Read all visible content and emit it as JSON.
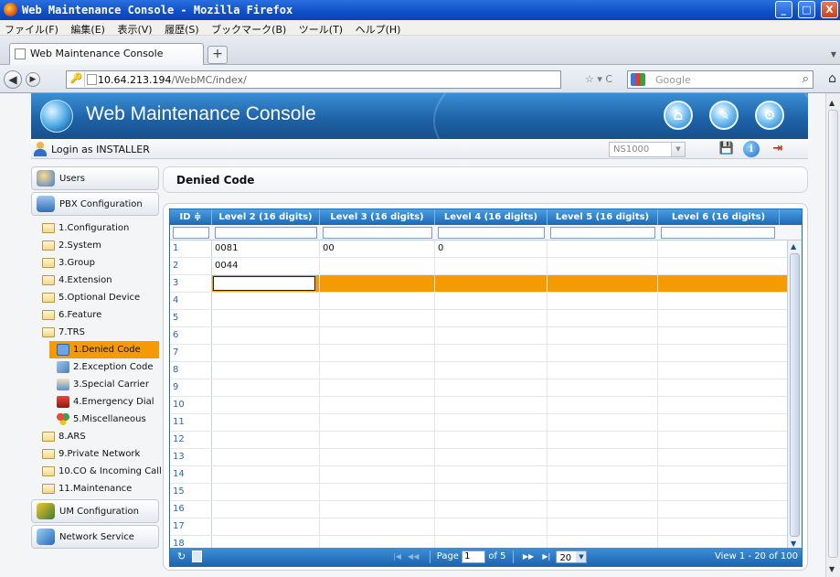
{
  "window": {
    "title": "Web Maintenance Console - Mozilla Firefox",
    "buttons": [
      "_",
      "□",
      "X"
    ]
  },
  "menubar": {
    "items": [
      "ファイル(F)",
      "編集(E)",
      "表示(V)",
      "履歴(S)",
      "ブックマーク(B)",
      "ツール(T)",
      "ヘルプ(H)"
    ]
  },
  "browser": {
    "tab_title": "Web Maintenance Console",
    "new_tab": "+",
    "url_host": "10.64.213.194",
    "url_path": "/WebMC/index/",
    "url_tools": "☆ ▾ C",
    "search_placeholder": "Google"
  },
  "app": {
    "title": "Web Maintenance Console",
    "login_text": "Login as INSTALLER",
    "system_select": "NS1000"
  },
  "sidebar": {
    "sections": {
      "users": "Users",
      "pbx": "PBX Configuration",
      "um": "UM Configuration",
      "network": "Network Service"
    },
    "tree": [
      "1.Configuration",
      "2.System",
      "3.Group",
      "4.Extension",
      "5.Optional Device",
      "6.Feature",
      "7.TRS"
    ],
    "trs_children": [
      "1.Denied Code",
      "2.Exception Code",
      "3.Special Carrier",
      "4.Emergency Dial",
      "5.Miscellaneous"
    ],
    "tree_after": [
      "8.ARS",
      "9.Private Network",
      "10.CO & Incoming Call",
      "11.Maintenance"
    ]
  },
  "main": {
    "page_title": "Denied Code",
    "columns": [
      "ID ≑",
      "Level 2 (16 digits)",
      "Level 3 (16 digits)",
      "Level 4 (16 digits)",
      "Level 5 (16 digits)",
      "Level 6 (16 digits)"
    ],
    "rows": [
      {
        "id": "1",
        "cells": [
          "0081",
          "00",
          "0",
          "",
          ""
        ]
      },
      {
        "id": "2",
        "cells": [
          "0044",
          "",
          "",
          "",
          ""
        ]
      },
      {
        "id": "3",
        "cells": [
          "",
          "",
          "",
          "",
          ""
        ]
      },
      {
        "id": "4",
        "cells": [
          "",
          "",
          "",
          "",
          ""
        ]
      },
      {
        "id": "5",
        "cells": [
          "",
          "",
          "",
          "",
          ""
        ]
      },
      {
        "id": "6",
        "cells": [
          "",
          "",
          "",
          "",
          ""
        ]
      },
      {
        "id": "7",
        "cells": [
          "",
          "",
          "",
          "",
          ""
        ]
      },
      {
        "id": "8",
        "cells": [
          "",
          "",
          "",
          "",
          ""
        ]
      },
      {
        "id": "9",
        "cells": [
          "",
          "",
          "",
          "",
          ""
        ]
      },
      {
        "id": "10",
        "cells": [
          "",
          "",
          "",
          "",
          ""
        ]
      },
      {
        "id": "11",
        "cells": [
          "",
          "",
          "",
          "",
          ""
        ]
      },
      {
        "id": "12",
        "cells": [
          "",
          "",
          "",
          "",
          ""
        ]
      },
      {
        "id": "13",
        "cells": [
          "",
          "",
          "",
          "",
          ""
        ]
      },
      {
        "id": "14",
        "cells": [
          "",
          "",
          "",
          "",
          ""
        ]
      },
      {
        "id": "15",
        "cells": [
          "",
          "",
          "",
          "",
          ""
        ]
      },
      {
        "id": "16",
        "cells": [
          "",
          "",
          "",
          "",
          ""
        ]
      },
      {
        "id": "17",
        "cells": [
          "",
          "",
          "",
          "",
          ""
        ]
      },
      {
        "id": "18",
        "cells": [
          "",
          "",
          "",
          "",
          ""
        ]
      }
    ],
    "selected_row": "3",
    "pager": {
      "page_label": "Page",
      "page": "1",
      "of_label": "of 5",
      "page_size": "20",
      "view_text": "View 1 - 20 of 100"
    }
  },
  "colors": {
    "accent": "#f59a00",
    "header_blue": "#1e63a8",
    "grid_blue": "#1a69b8"
  }
}
